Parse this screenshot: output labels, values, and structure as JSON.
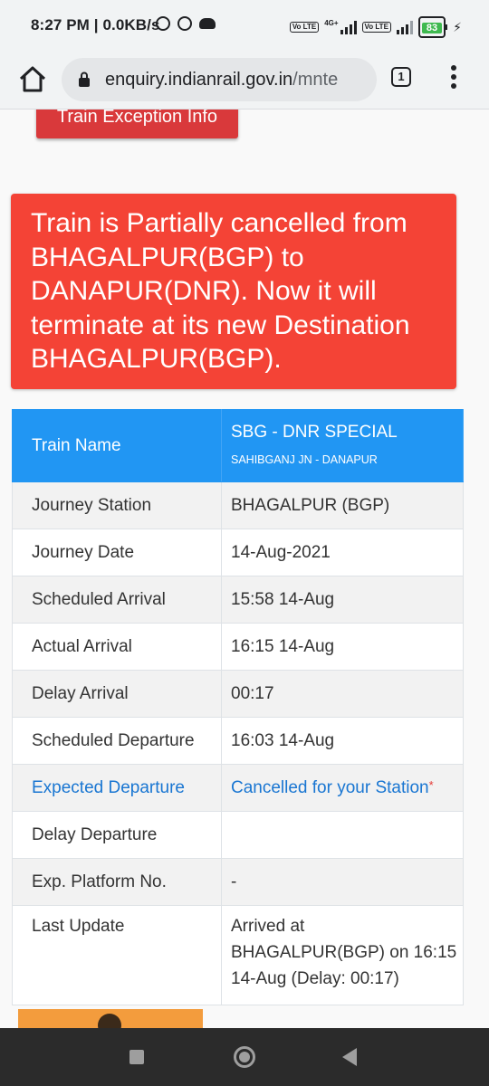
{
  "status_bar": {
    "time": "8:27 PM | 0.0KB/s",
    "network_type": "4G+",
    "volte_1": "Vo LTE",
    "volte_2": "Vo LTE",
    "battery": "83"
  },
  "browser": {
    "url_domain": "enquiry.indianrail.gov.in",
    "url_path": "/mnte",
    "tab_count": "1"
  },
  "exception_button": "Train Exception Info",
  "alert_message": "Train is Partially cancelled from BHAGALPUR(BGP) to DANAPUR(DNR). Now it will terminate at its new Destination BHAGALPUR(BGP).",
  "train": {
    "name_label": "Train Name",
    "name_value": "SBG - DNR SPECIAL",
    "route": "SAHIBGANJ JN - DANAPUR"
  },
  "rows": [
    {
      "label": "Journey Station",
      "value": "BHAGALPUR (BGP)"
    },
    {
      "label": "Journey Date",
      "value": "14-Aug-2021"
    },
    {
      "label": "Scheduled Arrival",
      "value": "15:58 14-Aug"
    },
    {
      "label": "Actual Arrival",
      "value": "16:15 14-Aug"
    },
    {
      "label": "Delay Arrival",
      "value": "00:17"
    },
    {
      "label": "Scheduled Departure",
      "value": "16:03 14-Aug"
    },
    {
      "label": "Expected Departure",
      "value": "Cancelled for your Station",
      "marker": "*"
    },
    {
      "label": "Delay Departure",
      "value": ""
    },
    {
      "label": "Exp. Platform No.",
      "value": "-"
    },
    {
      "label": "Last Update",
      "value": "Arrived at BHAGALPUR(BGP) on 16:15 14-Aug (Delay: 00:17)"
    }
  ],
  "colors": {
    "alert": "#f44336",
    "header": "#2196f3",
    "button": "#d9393b",
    "link": "#1976d2"
  }
}
